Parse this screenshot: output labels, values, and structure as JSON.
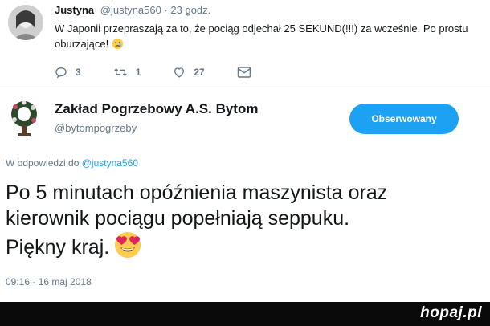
{
  "original_tweet": {
    "name": "Justyna",
    "meta": "@justyna560 · 23 godz.",
    "text": "W Japonii przepraszają za to, że pociąg odjechał 25 SEKUND(!!!) za wcześnie. Po prostu oburzające!",
    "replies": "3",
    "retweets": "1",
    "likes": "27"
  },
  "reply_account": {
    "name": "Zakład Pogrzebowy A.S. Bytom",
    "handle": "@bytompogrzeby",
    "follow_label": "Obserwowany"
  },
  "reply": {
    "prefix": "W odpowiedzi do ",
    "to": "@justyna560",
    "line1": "Po 5 minutach opóźnienia maszynista oraz",
    "line2": "kierownik pociągu popełniają seppuku.",
    "line3": "Piękny kraj.",
    "timestamp": "09:16 - 16 maj 2018"
  },
  "watermark": "hopaj.pl",
  "colors": {
    "accent": "#1da1f2",
    "secondary_text": "#657786",
    "bar": "#0a0a0a"
  }
}
